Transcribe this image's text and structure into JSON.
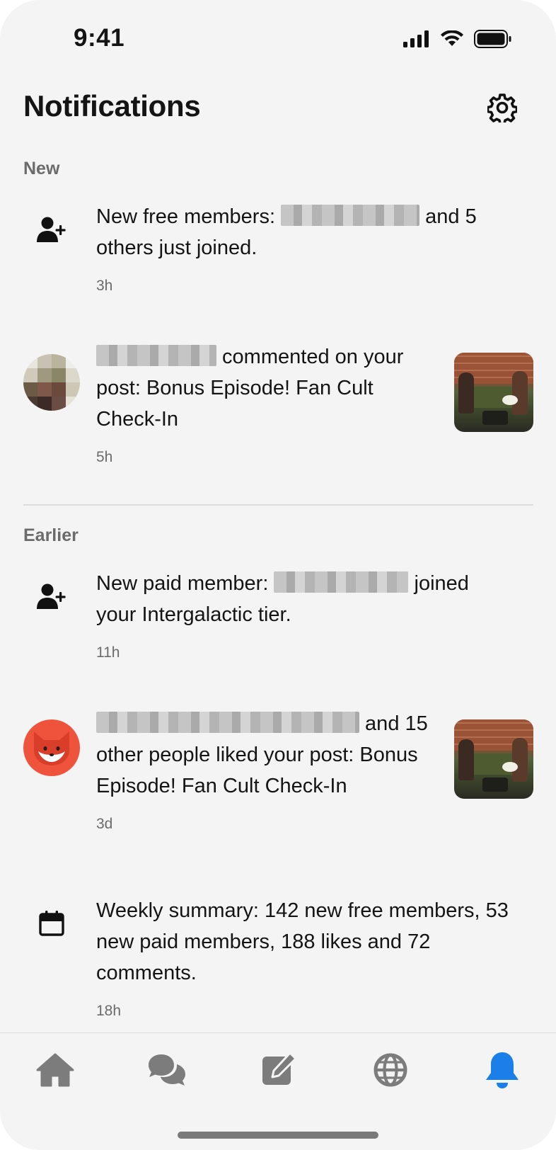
{
  "status_bar": {
    "time": "9:41"
  },
  "header": {
    "title": "Notifications"
  },
  "sections": {
    "new_label": "New",
    "earlier_label": "Earlier"
  },
  "notifications": [
    {
      "text_before": "New free members: ",
      "redacted": true,
      "text_after": " and 5 others just joined.",
      "time": "3h",
      "icon": "add-user-icon"
    },
    {
      "text_before": "",
      "redacted": true,
      "text_after": " commented on your post: Bonus Episode! Fan Cult Check-In",
      "time": "5h",
      "icon": "user-avatar"
    },
    {
      "text_before": "New paid member: ",
      "redacted": true,
      "text_after": " joined your Intergalactic tier.",
      "time": "11h",
      "icon": "add-user-icon"
    },
    {
      "text_before": "",
      "redacted": true,
      "text_after": " and 15 other people liked your post: Bonus Episode! Fan Cult Check-In",
      "time": "3d",
      "icon": "fox-avatar"
    },
    {
      "text_before": "Weekly summary: 142 new free members, 53 new paid members, 188 likes and 72 comments.",
      "redacted": false,
      "text_after": "",
      "time": "18h",
      "icon": "calendar-icon"
    }
  ],
  "tab_bar": {
    "tabs": [
      "home",
      "chats",
      "compose",
      "explore",
      "notifications"
    ],
    "active": "notifications",
    "active_color": "#1a7fe8",
    "inactive_color": "#7c7c7c"
  }
}
